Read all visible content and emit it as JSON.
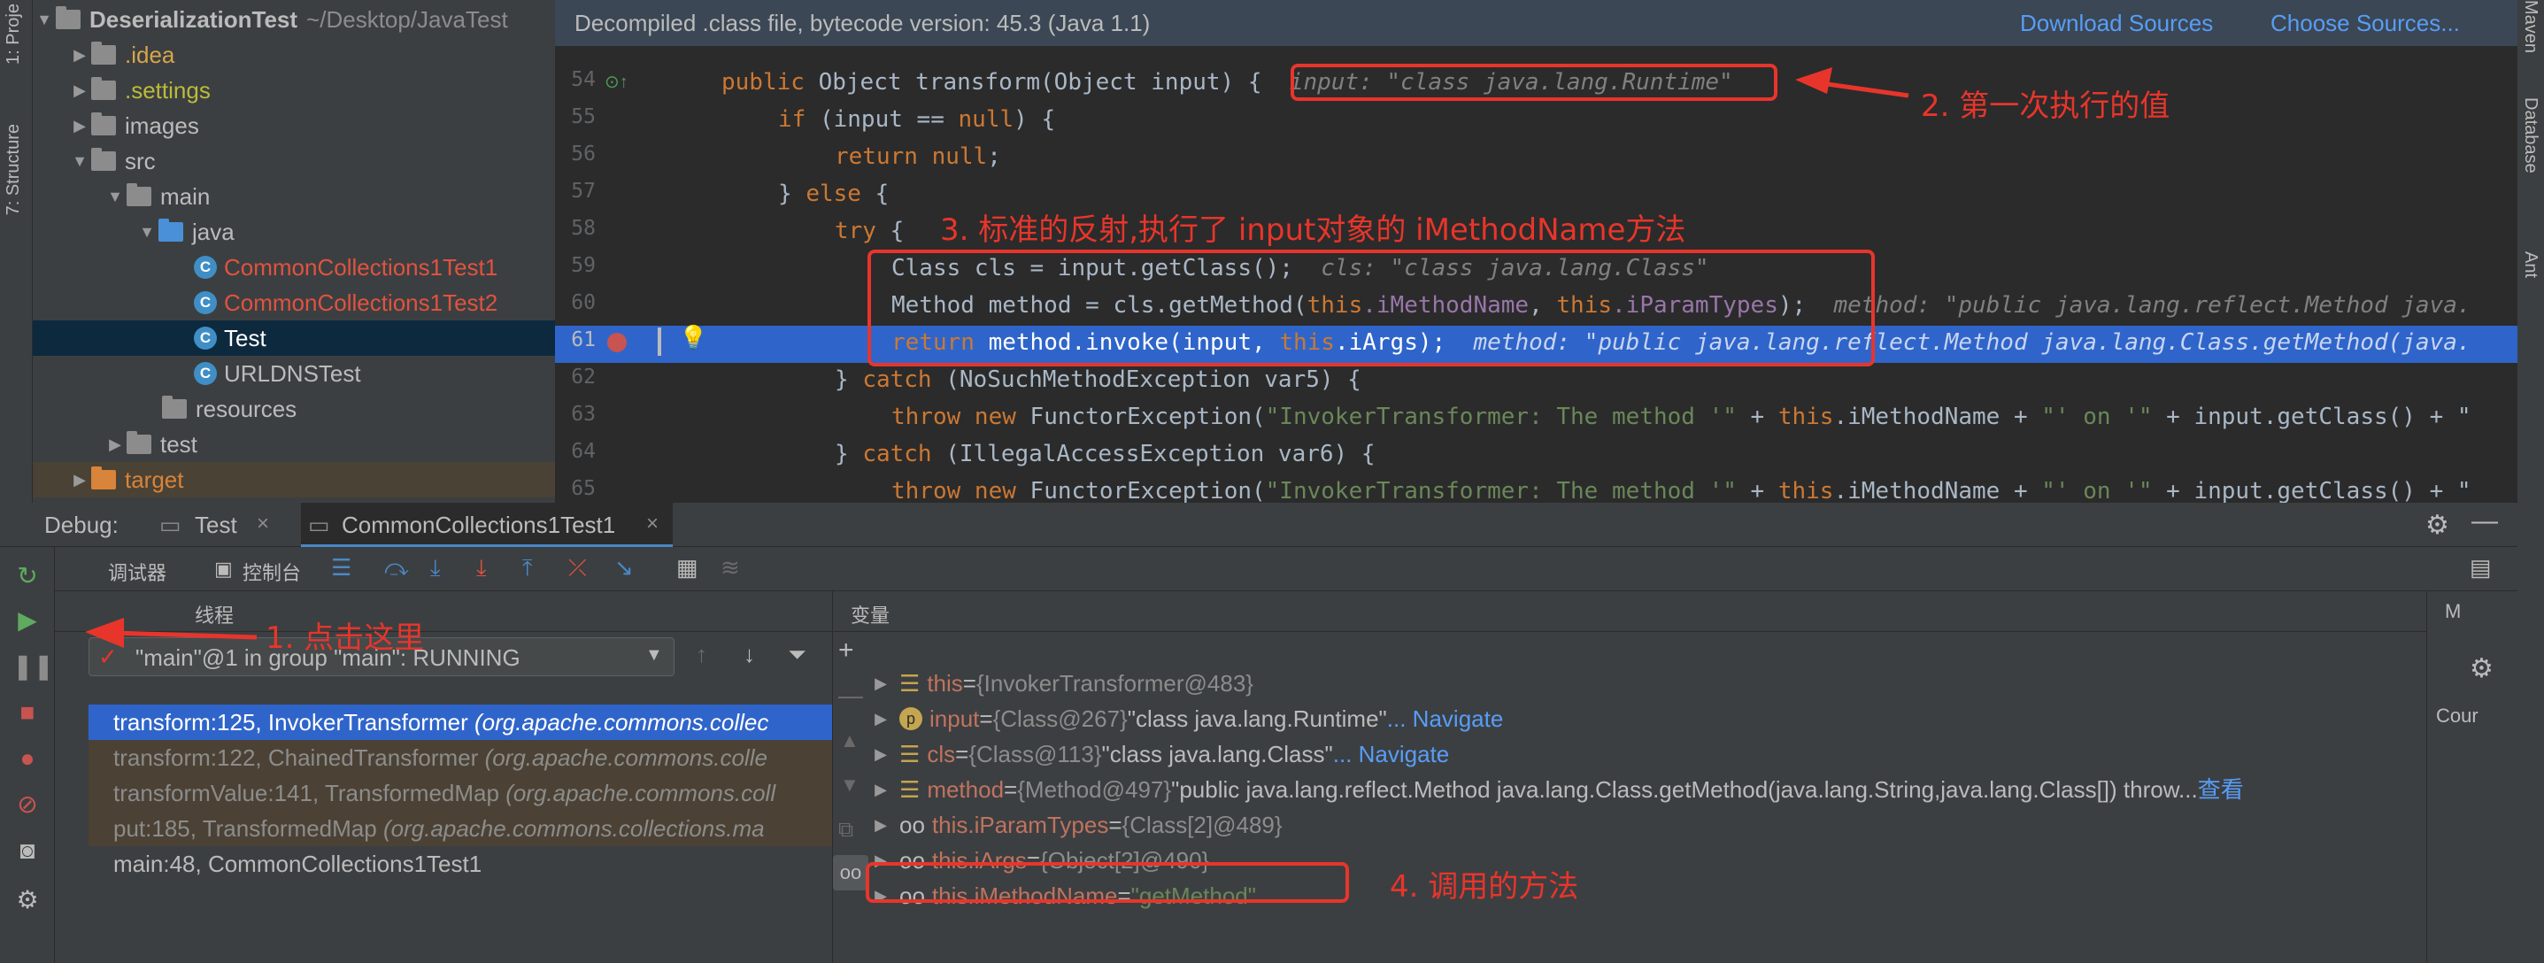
{
  "left_strip": {
    "project": "1: Proje",
    "structure": "7: Structure"
  },
  "right_strip": {
    "maven": "Maven",
    "database": "Database",
    "ant": "Ant"
  },
  "tree": {
    "root": "DeserializationTest",
    "root_path": "~/Desktop/JavaTest",
    "items": [
      {
        "label": ".idea"
      },
      {
        "label": ".settings"
      },
      {
        "label": "images"
      },
      {
        "label": "src"
      },
      {
        "label": "main"
      },
      {
        "label": "java"
      },
      {
        "label": "CommonCollections1Test1"
      },
      {
        "label": "CommonCollections1Test2"
      },
      {
        "label": "Test"
      },
      {
        "label": "URLDNSTest"
      },
      {
        "label": "resources"
      },
      {
        "label": "test"
      },
      {
        "label": "target"
      }
    ]
  },
  "editor": {
    "banner": "Decompiled .class file, bytecode version: 45.3 (Java 1.1)",
    "download_sources": "Download Sources",
    "choose_sources": "Choose Sources...",
    "line_numbers": [
      "54",
      "55",
      "56",
      "57",
      "58",
      "59",
      "60",
      "61",
      "62",
      "63",
      "64",
      "65"
    ],
    "lines": {
      "l54a": "public ",
      "l54b": "Object transform(Object input) {",
      "l54h": "input: \"class java.lang.Runtime\"",
      "l55a": "if ",
      "l55b": "(input == ",
      "l55c": "null",
      "l55d": ") {",
      "l56a": "return null",
      ";": ";",
      "l57a": "} ",
      "l57b": "else",
      " l57c": " {",
      "l58a": "try",
      " l58b": " {",
      "l59a": "Class cls = input.getClass();",
      "l59h": "cls: \"class java.lang.Class\"",
      "l60a": "Method method = cls.getMethod(",
      "l60b": "this",
      ".iMethodName": ".iMethodName",
      ", ": ", ",
      "l60c": "this",
      "l60d": ".iParamTypes",
      ");": ");",
      "l60h": "method: \"public java.lang.reflect.Method java.",
      "l61a": "return ",
      "l61b": "method.invoke(input, ",
      "l61c": "this",
      "l61d": ".iArgs);",
      "l61h": "method: \"public java.lang.reflect.Method java.lang.Class.getMethod(java.",
      "l62a": "} ",
      "l62b": "catch ",
      "l62c": "(NoSuchMethodException var5) {",
      "l63a": "throw new ",
      "l63b": "FunctorException(",
      "l63c": "\"InvokerTransformer: The method '\"",
      "l63d": " + ",
      "l63e": "this",
      "l63f": ".iMethodName + ",
      "l63g": "\"' on '\"",
      "l63h": " + input.getClass() + \"",
      "l64a": "} ",
      "l64b": "catch ",
      "l64c": "(IllegalAccessException var6) {",
      "l65a": "throw new ",
      "l65b": "FunctorException(",
      "l65c": "\"InvokerTransformer: The method '\"",
      "l65d": " + ",
      "l65e": "this",
      "l65f": ".iMethodName + ",
      "l65g": "\"' on '\"",
      "l65h": " + input.getClass() + \""
    }
  },
  "debug": {
    "label": "Debug:",
    "tab1": "Test",
    "tab2": "CommonCollections1Test1",
    "debugger_tab": "调试器",
    "console_tab": "控制台",
    "threads_label": "线程",
    "vars_label": "变量",
    "thread_selector": "\"main\"@1 in group \"main\": RUNNING",
    "frames": [
      {
        "method": "transform:125, InvokerTransformer",
        "pkg": "(org.apache.commons.collec"
      },
      {
        "method": "transform:122, ChainedTransformer",
        "pkg": "(org.apache.commons.colle"
      },
      {
        "method": "transformValue:141, TransformedMap",
        "pkg": "(org.apache.commons.coll"
      },
      {
        "method": "put:185, TransformedMap",
        "pkg": "(org.apache.commons.collections.ma"
      },
      {
        "method": "main:48, CommonCollections1Test1",
        "pkg": ""
      }
    ],
    "vars": [
      {
        "name": "this",
        "eq": " = ",
        "val": "{InvokerTransformer@483}",
        "extra": "",
        "link": ""
      },
      {
        "name": "input",
        "eq": " = ",
        "val": "{Class@267} ",
        "extra": "\"class java.lang.Runtime\"",
        "link": " ... Navigate"
      },
      {
        "name": "cls",
        "eq": " = ",
        "val": "{Class@113} ",
        "extra": "\"class java.lang.Class\"",
        "link": " ... Navigate"
      },
      {
        "name": "method",
        "eq": " = ",
        "val": "{Method@497} ",
        "extra": "\"public java.lang.reflect.Method java.lang.Class.getMethod(java.lang.String,java.lang.Class[]) throw...",
        "link": " 查看"
      },
      {
        "name": "this.iParamTypes",
        "eq": " = ",
        "val": "{Class[2]@489}",
        "extra": "",
        "link": ""
      },
      {
        "name": "this.iArgs",
        "eq": " = ",
        "val": "{Object[2]@490}",
        "extra": "",
        "link": ""
      },
      {
        "name": "this.iMethodName",
        "eq": " = ",
        "val": "",
        "extra": "\"getMethod\"",
        "link": ""
      }
    ],
    "right_tab": "M",
    "count_label": "Cour"
  },
  "annotations": {
    "a1": "1. 点击这里",
    "a2": "2. 第一次执行的值",
    "a3": "3. 标准的反射,执行了 input对象的 iMethodName方法",
    "a4": "4. 调用的方法"
  },
  "colors": {
    "accent": "#e8352b",
    "selection": "#2f65ca",
    "link": "#589df6"
  }
}
